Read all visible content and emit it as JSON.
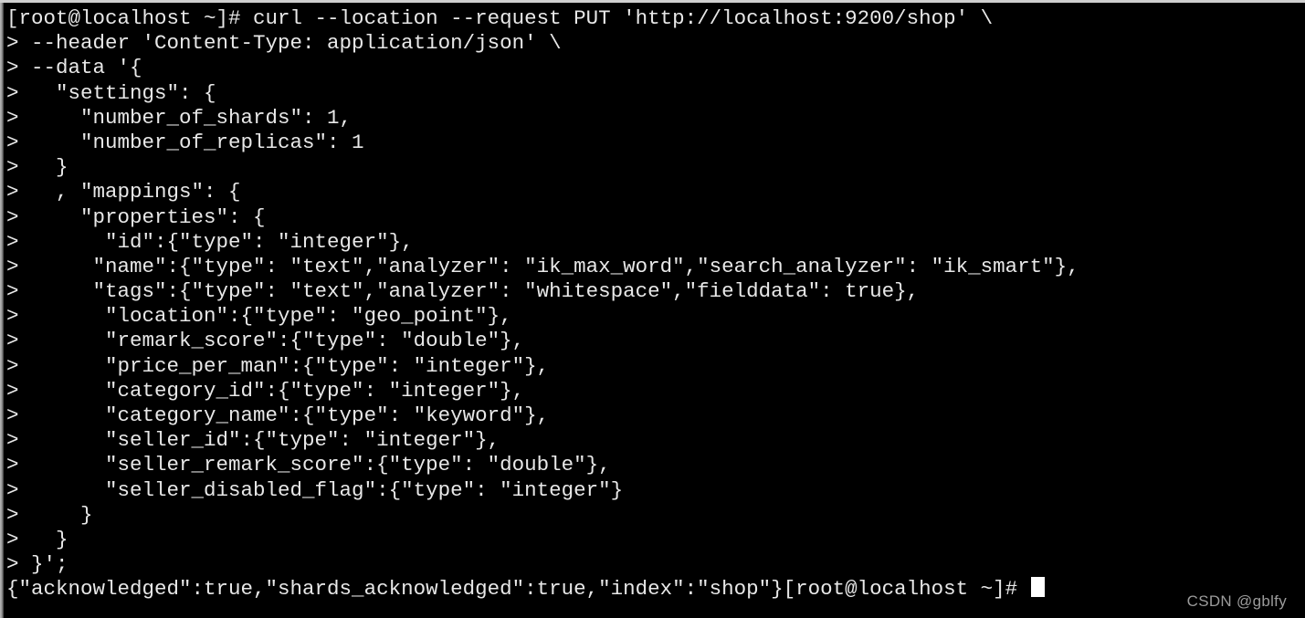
{
  "terminal": {
    "prompt": "[root@localhost ~]#",
    "continuation": ">",
    "lines": [
      "[root@localhost ~]# curl --location --request PUT 'http://localhost:9200/shop' \\",
      "> --header 'Content-Type: application/json' \\",
      "> --data '{",
      ">   \"settings\": {",
      ">     \"number_of_shards\": 1,",
      ">     \"number_of_replicas\": 1",
      ">   }",
      ">   , \"mappings\": {",
      ">     \"properties\": {",
      ">       \"id\":{\"type\": \"integer\"},",
      ">      \"name\":{\"type\": \"text\",\"analyzer\": \"ik_max_word\",\"search_analyzer\": \"ik_smart\"},",
      ">      \"tags\":{\"type\": \"text\",\"analyzer\": \"whitespace\",\"fielddata\": true},",
      ">       \"location\":{\"type\": \"geo_point\"},",
      ">       \"remark_score\":{\"type\": \"double\"},",
      ">       \"price_per_man\":{\"type\": \"integer\"},",
      ">       \"category_id\":{\"type\": \"integer\"},",
      ">       \"category_name\":{\"type\": \"keyword\"},",
      ">       \"seller_id\":{\"type\": \"integer\"},",
      ">       \"seller_remark_score\":{\"type\": \"double\"},",
      ">       \"seller_disabled_flag\":{\"type\": \"integer\"}",
      ">     }",
      ">   }",
      "> }';"
    ],
    "response_line": "{\"acknowledged\":true,\"shards_acknowledged\":true,\"index\":\"shop\"}[root@localhost ~]#",
    "cursor": "block",
    "colors": {
      "background": "#000000",
      "foreground": "#e8e8e8",
      "cursor": "#ffffff",
      "window_border": "#cfcfcf"
    }
  },
  "watermark": {
    "text": "CSDN @gblfy"
  }
}
